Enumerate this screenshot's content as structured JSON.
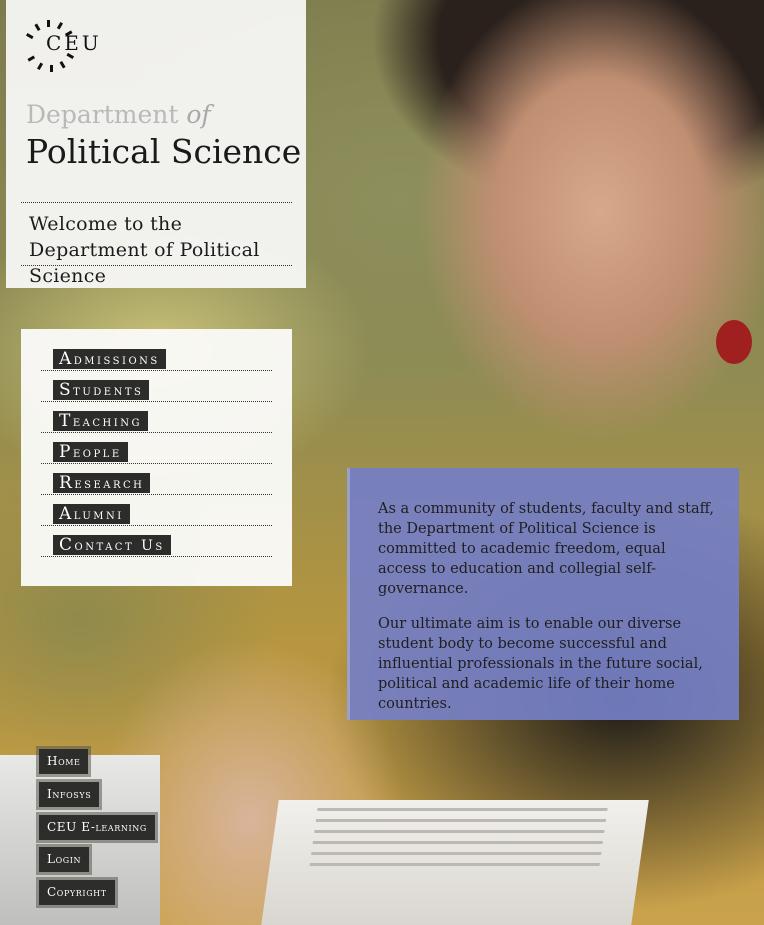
{
  "logo": {
    "text": "CEU"
  },
  "header": {
    "dept_prefix": "Department",
    "dept_of": "of",
    "dept_name": "Political Science",
    "welcome": "Welcome to the Department of Political Science"
  },
  "nav": {
    "items": [
      {
        "label": "Admissions"
      },
      {
        "label": "Students"
      },
      {
        "label": "Teaching"
      },
      {
        "label": "People"
      },
      {
        "label": "Research"
      },
      {
        "label": "Alumni"
      },
      {
        "label": "Contact Us"
      }
    ]
  },
  "info": {
    "paragraph1": "As a community of students, faculty and staff, the Department of Political Science is committed to academic freedom, equal access to education and collegial self-governance.",
    "paragraph2": "Our ultimate aim is to enable our diverse student body to become successful and influential professionals in the future social, political and academic life of their home countries."
  },
  "footer": {
    "links": [
      {
        "label": "Home"
      },
      {
        "label": "Infosys"
      },
      {
        "label": "CEU E-learning"
      },
      {
        "label": "Login"
      },
      {
        "label": "Copyright"
      }
    ]
  },
  "colors": {
    "info_box": "#757fc4",
    "nav_label_bg": "#2c2c2a",
    "panel_bg": "#f7f7f5"
  }
}
